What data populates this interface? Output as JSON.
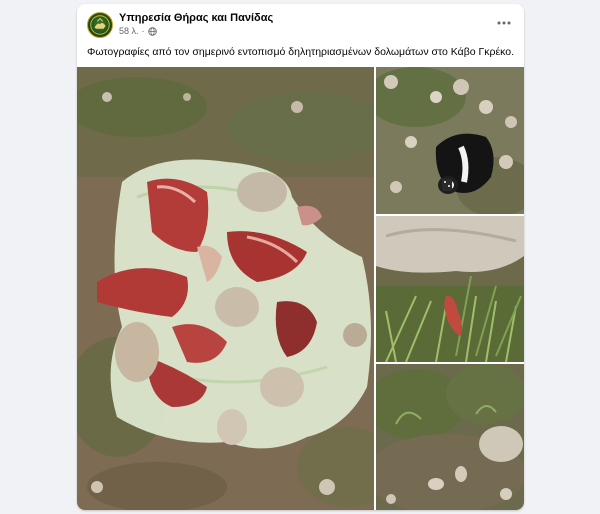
{
  "post": {
    "page_name": "Υπηρεσία Θήρας και Πανίδας",
    "time": "58 λ.",
    "separator": "·",
    "privacy_icon": "globe-icon",
    "more_icon": "more-horizontal-icon",
    "caption": "Φωτογραφίες από τον σημερινό εντοπισμό δηλητηριασμένων δολωμάτων στο Κάβο Γκρέκο."
  },
  "photos": [
    {
      "name": "poisoned-bait-meat-photo"
    },
    {
      "name": "dead-dog-photo"
    },
    {
      "name": "bait-on-grass-photo"
    },
    {
      "name": "rocks-and-grass-photo"
    }
  ],
  "colors": {
    "background": "#f0f2f5",
    "card": "#ffffff",
    "meta_text": "#65676b",
    "ground": "#7a6a52",
    "meat": "#b23a36",
    "bag": "#d8e8c6",
    "grass": "#5f7d3a"
  }
}
